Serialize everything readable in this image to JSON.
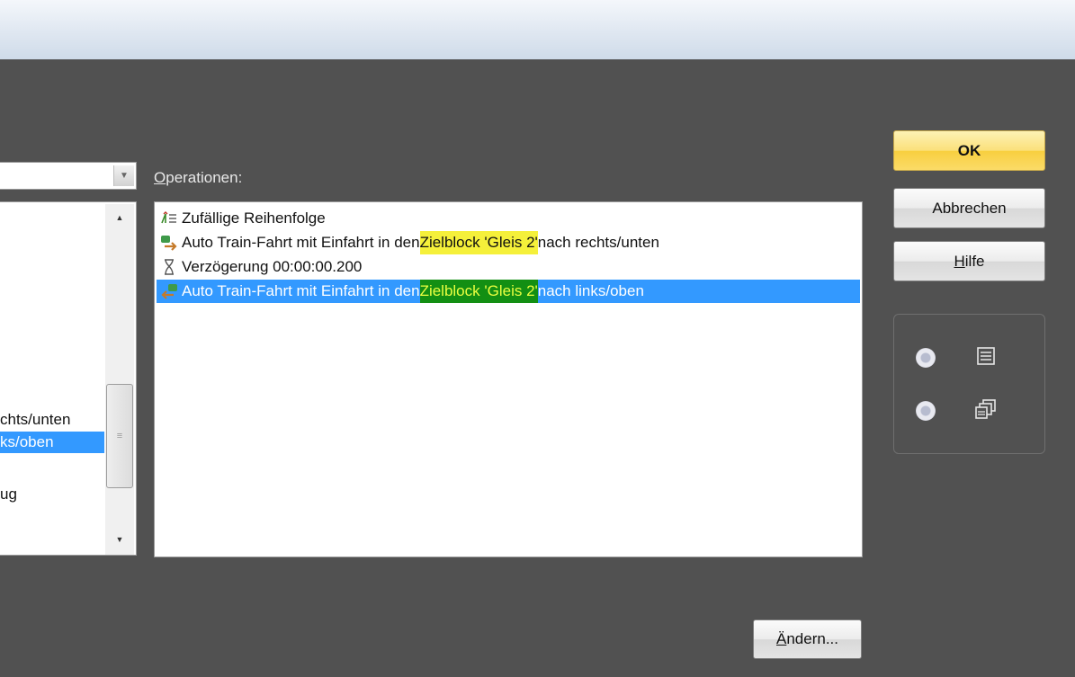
{
  "left_list": {
    "items": [
      {
        "label": "chts/unten",
        "selected": false
      },
      {
        "label": "ks/oben",
        "selected": true
      },
      {
        "label": "ug",
        "selected": false
      }
    ],
    "scroll_up_icon": "triangle-up",
    "scroll_down_icon": "triangle-down",
    "thumb_grip": "≡"
  },
  "operations": {
    "label_accel": "O",
    "label_rest": "perationen:",
    "items": [
      {
        "icon": "random-order-icon",
        "text": "Zufällige Reihenfolge",
        "pre": "Zufällige Reihenfolge",
        "hl": "",
        "post": "",
        "selected": false
      },
      {
        "icon": "autotrain-right-icon",
        "pre": "Auto Train-Fahrt mit Einfahrt in den ",
        "hl": "Zielblock 'Gleis 2'",
        "post": " nach rechts/unten",
        "selected": false
      },
      {
        "icon": "hourglass-icon",
        "pre": "Verzögerung 00:00:00.200",
        "hl": "",
        "post": "",
        "selected": false
      },
      {
        "icon": "autotrain-left-icon",
        "pre": "Auto Train-Fahrt mit Einfahrt in den ",
        "hl": "Zielblock 'Gleis 2'",
        "post": " nach links/oben",
        "selected": true
      }
    ]
  },
  "buttons": {
    "ok": "OK",
    "cancel": "Abbrechen",
    "help_accel": "H",
    "help_rest": "ilfe",
    "change_accel": "Ä",
    "change_rest": "ndern..."
  },
  "colors": {
    "panel_bg": "#515151",
    "selection": "#3399ff",
    "highlight_yellow": "#f5f03a",
    "highlight_green": "#138f13"
  }
}
